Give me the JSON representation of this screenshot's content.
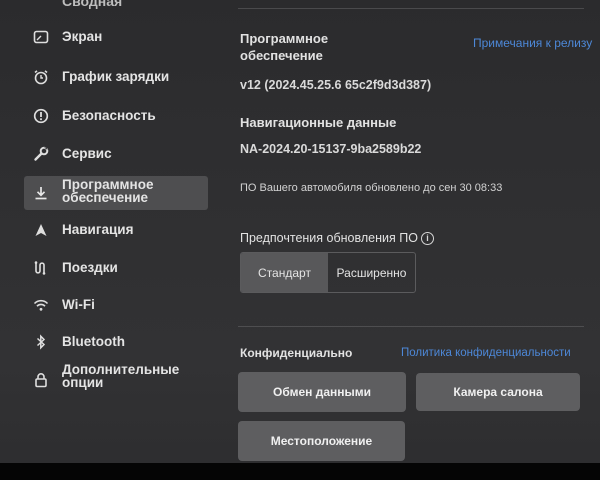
{
  "sidebar": {
    "top_partial": "Сводная",
    "items": [
      {
        "label": "Экран",
        "icon": "display-icon"
      },
      {
        "label": "График зарядки",
        "icon": "alarm-clock-icon"
      },
      {
        "label": "Безопасность",
        "icon": "alert-circle-icon"
      },
      {
        "label": "Сервис",
        "icon": "wrench-icon"
      },
      {
        "label": "Программное обеспечение",
        "icon": "download-icon",
        "active": true
      },
      {
        "label": "Навигация",
        "icon": "navigation-arrow-icon"
      },
      {
        "label": "Поездки",
        "icon": "trips-icon"
      },
      {
        "label": "Wi-Fi",
        "icon": "wifi-icon"
      },
      {
        "label": "Bluetooth",
        "icon": "bluetooth-icon"
      },
      {
        "label": "Дополнительные опции",
        "icon": "lock-icon"
      }
    ]
  },
  "software": {
    "heading": "Программное обеспечение",
    "release_notes_link": "Примечания к релизу",
    "version": "v12 (2024.45.25.6 65c2f9d3d387)",
    "nav_data_heading": "Навигационные данные",
    "nav_data_version": "NA-2024.20-15137-9ba2589b22",
    "updated_status": "ПО Вашего автомобиля обновлено до сен 30 08:33",
    "update_prefs_label": "Предпочтения обновления ПО",
    "update_options": [
      "Стандарт",
      "Расширенно"
    ],
    "selected_option": "Стандарт"
  },
  "privacy": {
    "heading": "Конфиденциально",
    "policy_link": "Политика конфиденциальности",
    "buttons": {
      "data_sharing": "Обмен данными",
      "cabin_camera": "Камера салона",
      "location": "Местоположение"
    }
  },
  "colors": {
    "link": "#4d88d8",
    "active_nav": "#4e4e50",
    "button": "#5e5e60"
  }
}
